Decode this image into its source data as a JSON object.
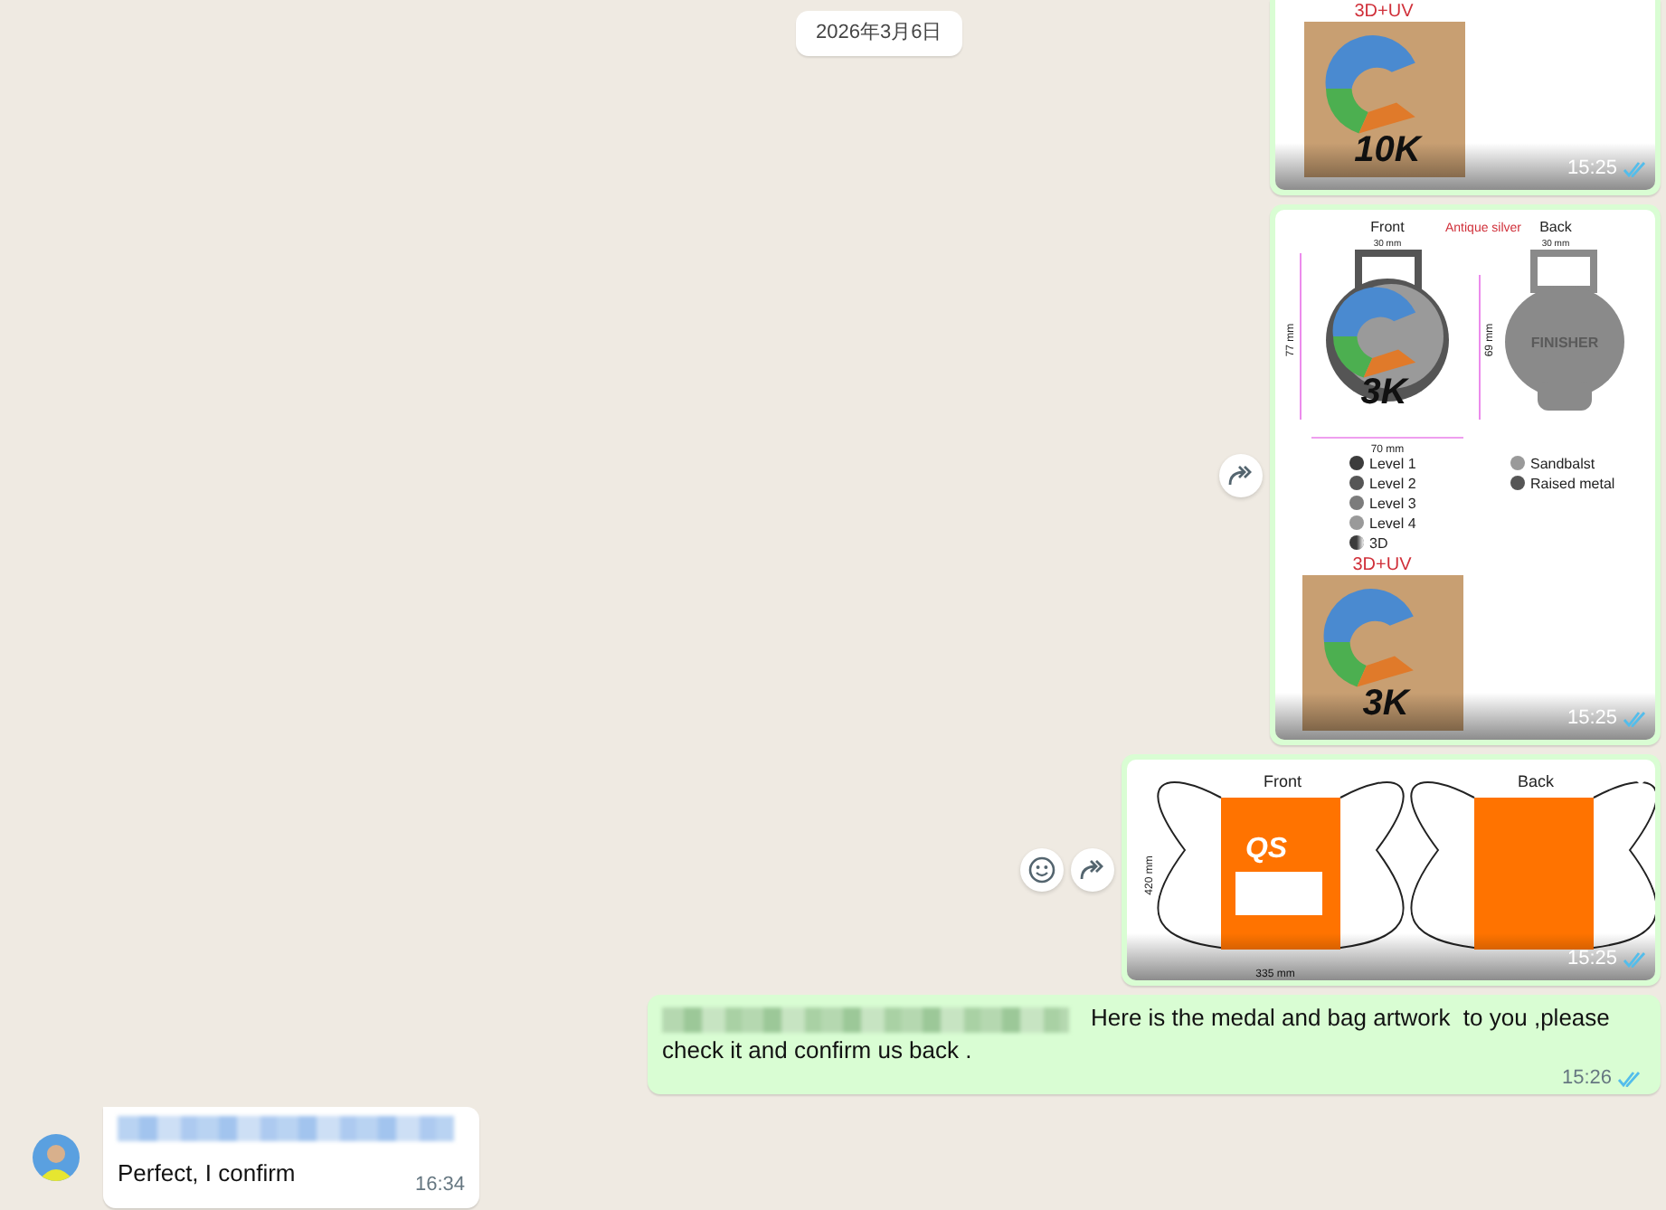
{
  "date_chip": "2026年3月6日",
  "messages": [
    {
      "kind": "uv_print",
      "outgoing": true,
      "label": "3D+UV",
      "distance": "10K",
      "time": "15:25",
      "read": true
    },
    {
      "kind": "medal_sheet",
      "outgoing": true,
      "front": "Front",
      "finish": "Antique silver",
      "back": "Back",
      "front_width": "30 mm",
      "back_width": "30 mm",
      "height": "77 mm",
      "inner_height": "69 mm",
      "width": "70 mm",
      "distance": "3K",
      "back_text": "FINISHER",
      "legend": [
        {
          "label": "Level 1",
          "color": "#3c3c3c",
          "kind": "dot"
        },
        {
          "label": "Level 2",
          "color": "#565656",
          "kind": "dot"
        },
        {
          "label": "Level 3",
          "color": "#7c7c7c",
          "kind": "dot"
        },
        {
          "label": "Level 4",
          "color": "#9a9a9a",
          "kind": "dot"
        },
        {
          "label": "3D",
          "color": "#3c3c3c",
          "kind": "gradient"
        }
      ],
      "legend_right": [
        {
          "label": "Sandbalst",
          "color": "#9a9a9a",
          "kind": "dot"
        },
        {
          "label": "Raised metal",
          "color": "#565656",
          "kind": "dot"
        }
      ],
      "uv_label": "3D+UV",
      "uv_distance": "3K",
      "time": "15:25",
      "read": true,
      "forward_button": true
    },
    {
      "kind": "bag_sheet",
      "outgoing": true,
      "front": "Front",
      "back": "Back",
      "height": "420 mm",
      "width": "335 mm",
      "logo": "QS",
      "time": "15:25",
      "read": true,
      "react_button": true,
      "forward_button": true
    },
    {
      "kind": "text",
      "outgoing": true,
      "sender_blurred": true,
      "text": "Here is the medal and bag artwork  to you ,please check it and confirm us back .",
      "time": "15:26",
      "read": true
    },
    {
      "kind": "text",
      "outgoing": false,
      "sender_blurred": true,
      "avatar": true,
      "text": "Perfect, I confirm",
      "time": "16:34"
    }
  ]
}
